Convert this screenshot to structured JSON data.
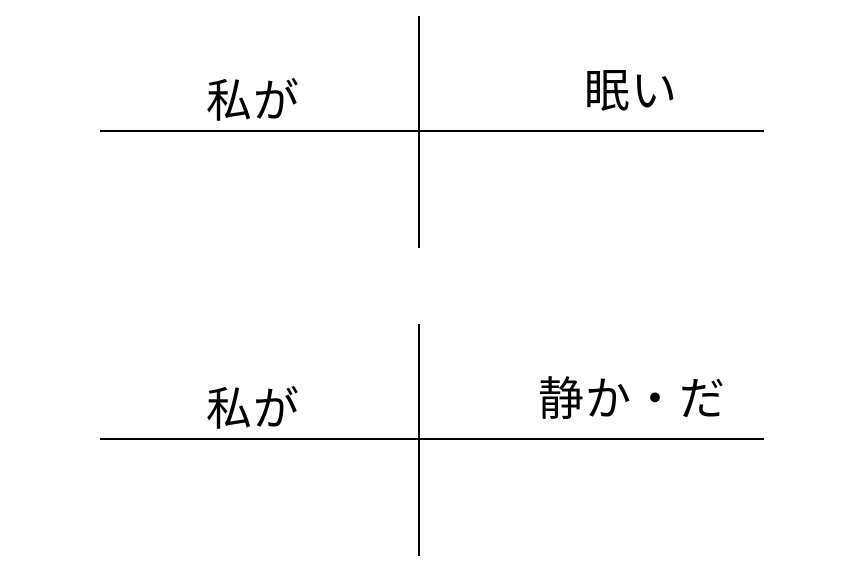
{
  "diagrams": [
    {
      "subject": "私が",
      "predicate": "眠い"
    },
    {
      "subject": "私が",
      "predicate": "静か・だ"
    }
  ],
  "colors": {
    "background": "#ffffff",
    "ink": "#000000"
  }
}
